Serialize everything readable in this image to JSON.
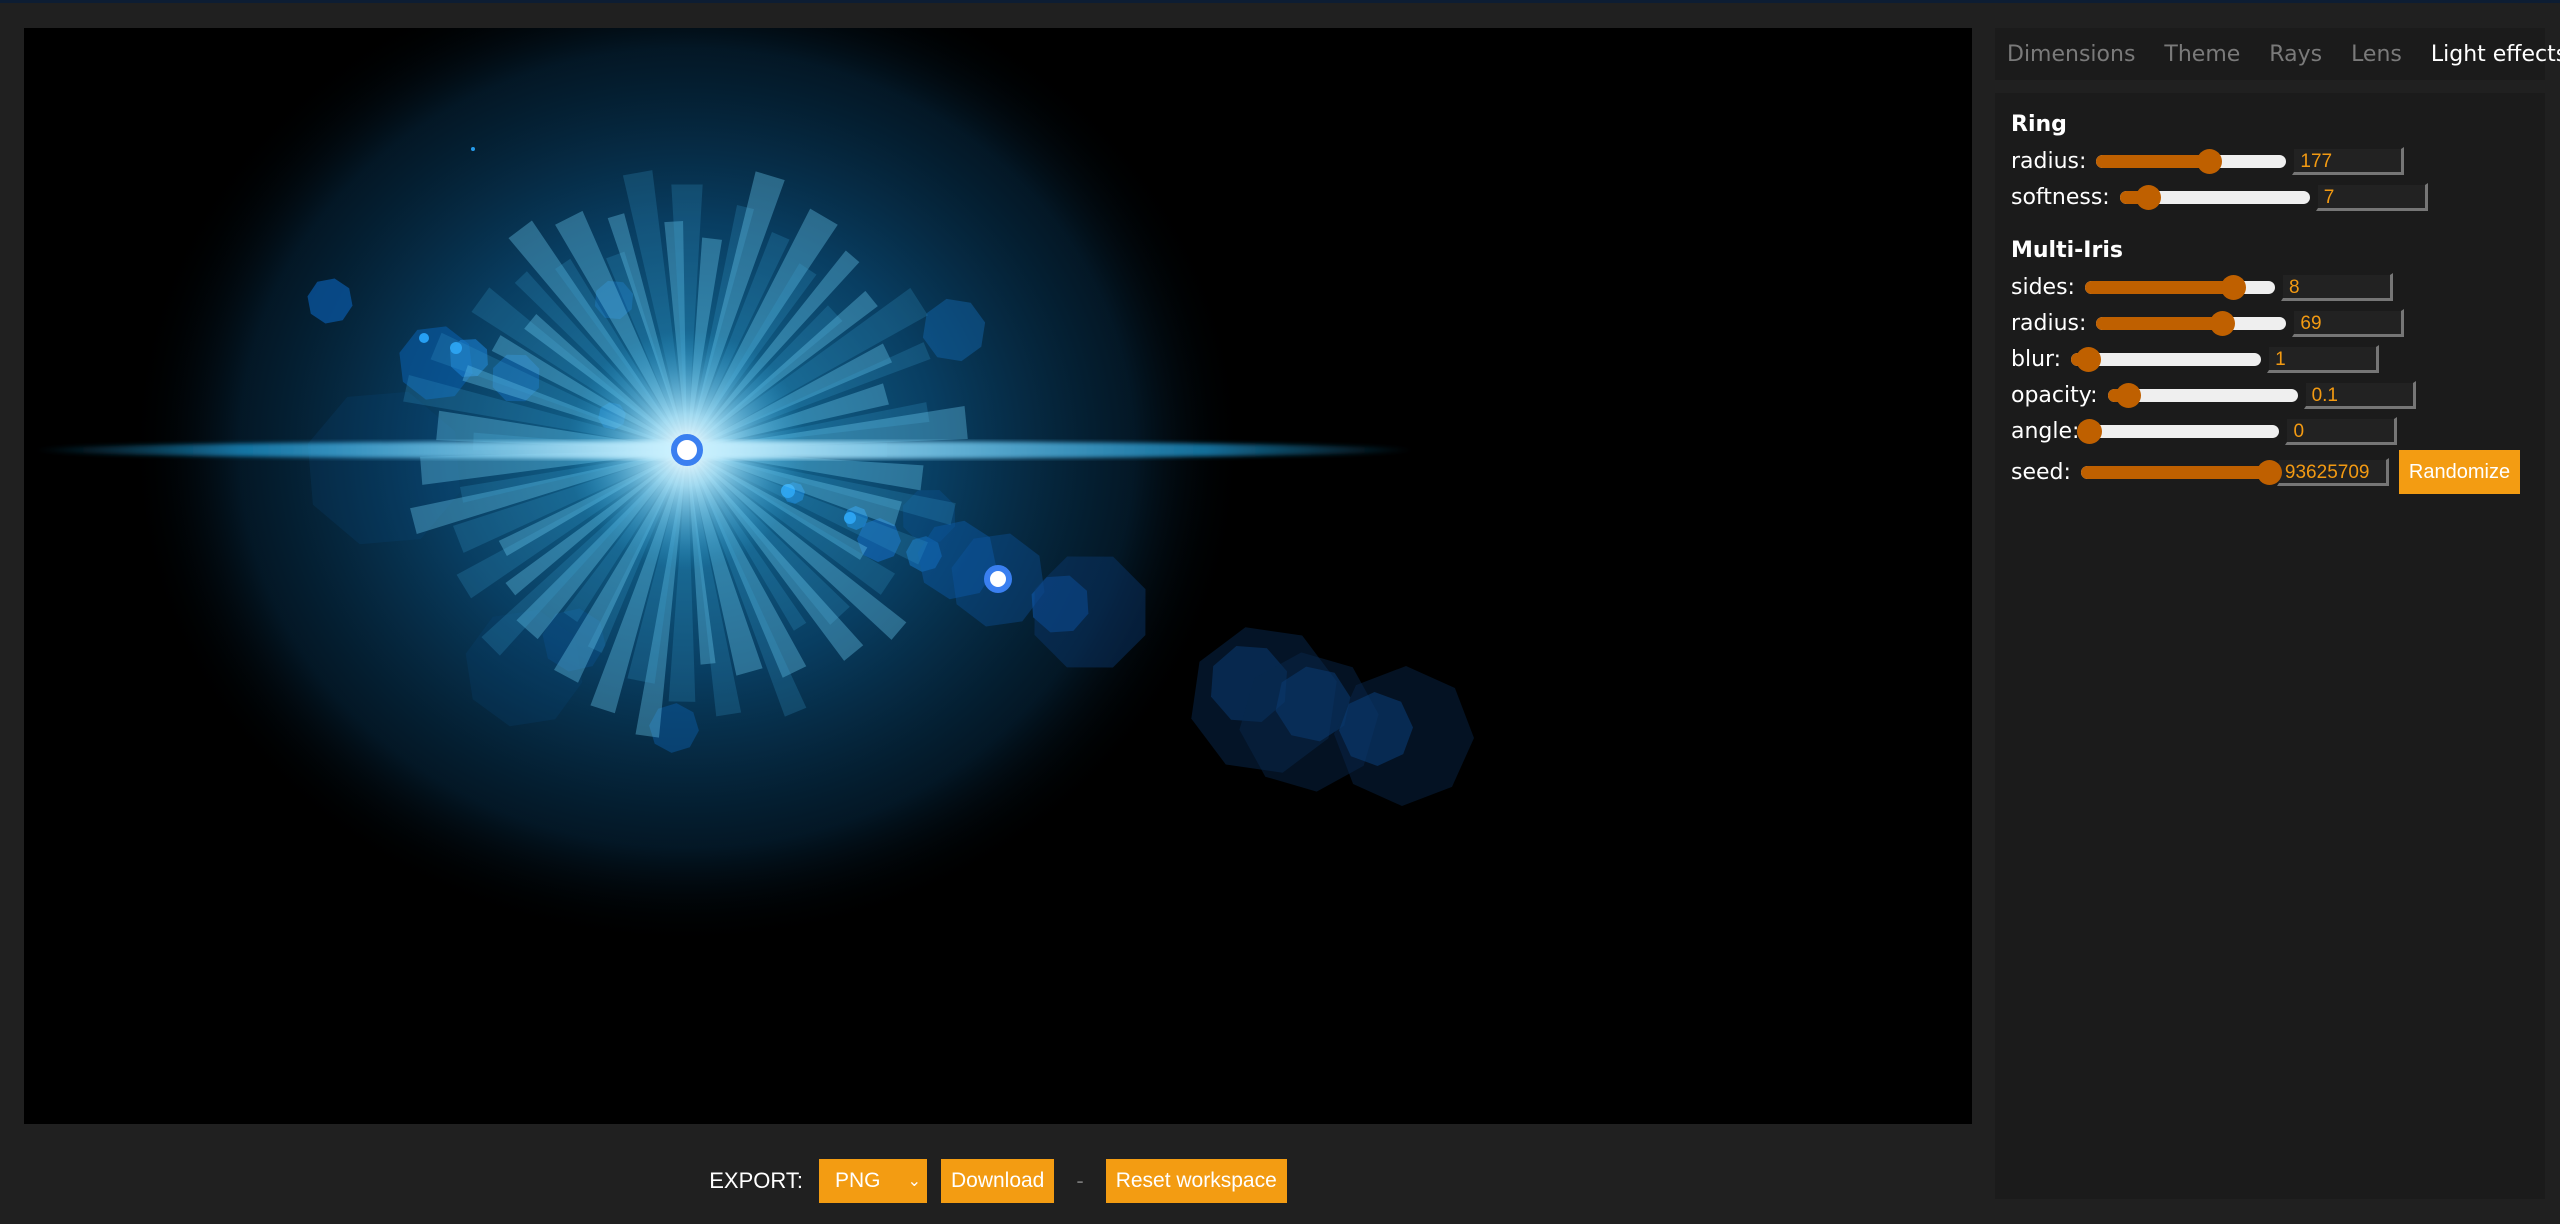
{
  "canvas": {
    "description": "lens flare preview",
    "main_light": {
      "label": "light-source-handle"
    },
    "secondary_handle": {
      "label": "flare-axis-handle"
    },
    "colors": {
      "glow": "#0a6da8",
      "ray": "#5fc8ef",
      "bokeh": "#0a5aa8",
      "handle_ring": "#3a86f0"
    }
  },
  "export": {
    "label": "EXPORT:",
    "format": "PNG",
    "download_label": "Download",
    "separator": "-",
    "reset_label": "Reset workspace"
  },
  "tabs": [
    {
      "label": "Dimensions",
      "active": false
    },
    {
      "label": "Theme",
      "active": false
    },
    {
      "label": "Rays",
      "active": false
    },
    {
      "label": "Lens",
      "active": false
    },
    {
      "label": "Light effects",
      "active": true
    }
  ],
  "ring": {
    "title": "Ring",
    "radius": {
      "label": "radius:",
      "value": "177",
      "fraction": 0.59
    },
    "softness": {
      "label": "softness:",
      "value": "7",
      "fraction": 0.15
    }
  },
  "multi_iris": {
    "title": "Multi-Iris",
    "sides": {
      "label": "sides:",
      "value": "8",
      "fraction": 0.78
    },
    "radius": {
      "label": "radius:",
      "value": "69",
      "fraction": 0.66
    },
    "blur": {
      "label": "blur:",
      "value": "1",
      "fraction": 0.09
    },
    "opacity": {
      "label": "opacity:",
      "value": "0.1",
      "fraction": 0.11
    },
    "angle": {
      "label": "angle:",
      "value": "0",
      "fraction": 0.0
    },
    "seed": {
      "label": "seed:",
      "value": "93625709",
      "fraction": 0.99
    },
    "randomize_label": "Randomize"
  },
  "accent": "#f39c12",
  "slider_color": "#bf6000"
}
